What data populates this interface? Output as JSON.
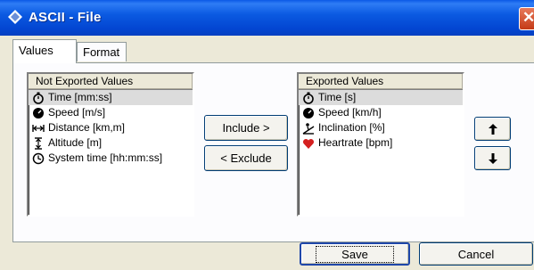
{
  "window": {
    "title": "ASCII - File",
    "title_icon": "diamond-app-icon"
  },
  "tabs": [
    {
      "label": "Values",
      "active": true
    },
    {
      "label": "Format",
      "active": false
    }
  ],
  "not_exported": {
    "header": "Not Exported Values",
    "items": [
      {
        "label": "Time [mm:ss]",
        "icon": "stopwatch-icon",
        "selected": true
      },
      {
        "label": "Speed [m/s]",
        "icon": "speedometer-icon",
        "selected": false
      },
      {
        "label": "Distance [km,m]",
        "icon": "distance-arrows-icon",
        "selected": false
      },
      {
        "label": "Altitude [m]",
        "icon": "altitude-icon",
        "selected": false
      },
      {
        "label": "System time [hh:mm:ss]",
        "icon": "clock-icon",
        "selected": false
      }
    ]
  },
  "exported": {
    "header": "Exported Values",
    "items": [
      {
        "label": "Time [s]",
        "icon": "stopwatch-icon",
        "selected": true
      },
      {
        "label": "Speed [km/h]",
        "icon": "speedometer-icon",
        "selected": false
      },
      {
        "label": "Inclination [%]",
        "icon": "inclination-icon",
        "selected": false
      },
      {
        "label": "Heartrate [bpm]",
        "icon": "heart-icon",
        "selected": false
      }
    ]
  },
  "buttons": {
    "include": "Include >",
    "exclude": "< Exclude",
    "save": "Save",
    "cancel": "Cancel"
  },
  "colors": {
    "titlebar": "#0a58e6",
    "heart": "#d42020",
    "selection": "#dcdcdc"
  }
}
